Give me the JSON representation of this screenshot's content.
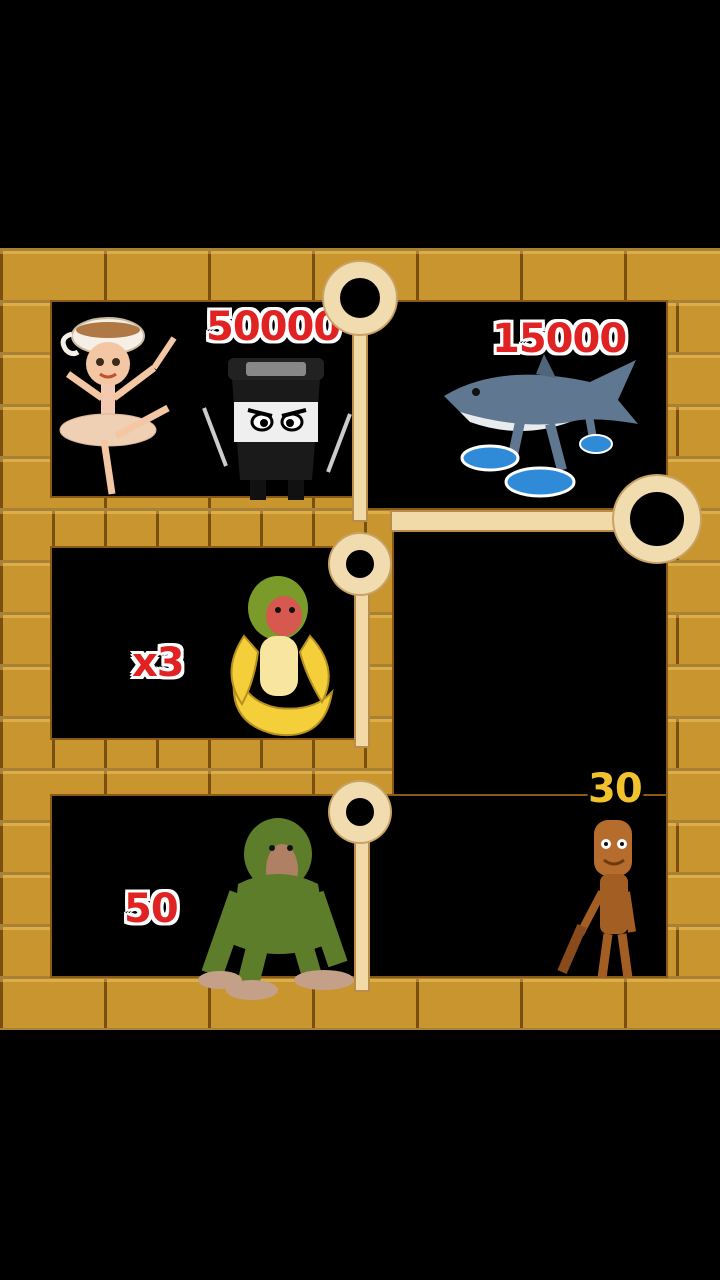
{
  "level": {
    "rooms": [
      {
        "id": "top-left",
        "score": "50000",
        "characters": [
          "ballerina-cappuccina",
          "ninja-coffee-cup"
        ]
      },
      {
        "id": "top-right",
        "score": "15000",
        "characters": [
          "shark-with-sneakers"
        ]
      },
      {
        "id": "middle-left",
        "score": "x3",
        "characters": [
          "monkey-in-banana"
        ]
      },
      {
        "id": "bottom-left",
        "score": "50",
        "characters": [
          "mossy-ape"
        ]
      },
      {
        "id": "bottom-right",
        "score": "30",
        "characters": [
          "wooden-figure-with-bat"
        ]
      }
    ]
  },
  "colors": {
    "brick": "#c9952f",
    "mortar": "#7a4f12",
    "score_red": "#e02222",
    "score_gold": "#f2c12e",
    "pin": "#f1dcb0"
  }
}
